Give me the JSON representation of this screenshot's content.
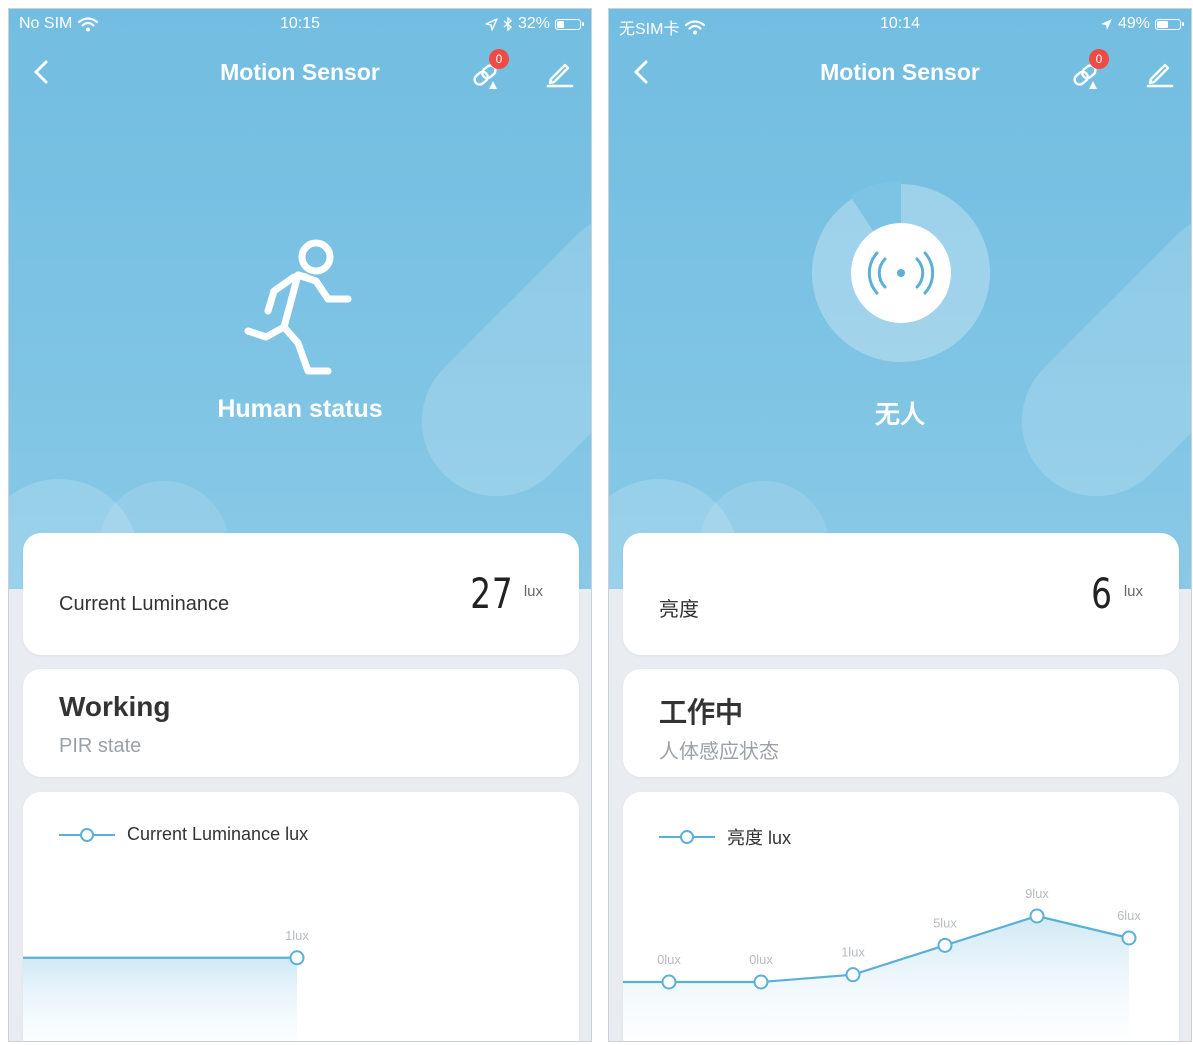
{
  "colors": {
    "hero": "#7dc3e4",
    "accent_line": "#5bb0d8",
    "badge": "#f04a45",
    "card": "#ffffff"
  },
  "left": {
    "status": {
      "carrier": "No SIM",
      "time": "10:15",
      "battery": "32%",
      "battery_level": 0.32,
      "icons": [
        "wifi-icon",
        "location-arrow-icon",
        "bluetooth-icon",
        "battery-icon"
      ]
    },
    "nav": {
      "title": "Motion Sensor",
      "badge": "0"
    },
    "hero_icon": "running-person-icon",
    "state_label": "Human status",
    "luminance": {
      "label": "Current Luminance",
      "value": "27",
      "unit": "lux"
    },
    "pir": {
      "title": "Working",
      "subtitle": "PIR state"
    },
    "chart": {
      "legend": "Current Luminance lux"
    }
  },
  "right": {
    "status": {
      "carrier": "无SIM卡",
      "time": "10:14",
      "battery": "49%",
      "battery_level": 0.49,
      "icons": [
        "wifi-icon",
        "location-arrow-icon",
        "battery-icon"
      ]
    },
    "nav": {
      "title": "Motion Sensor",
      "badge": "0"
    },
    "hero_icon": "radar-signal-icon",
    "state_label": "无人",
    "luminance": {
      "label": "亮度",
      "value": "6",
      "unit": "lux"
    },
    "pir": {
      "title": "工作中",
      "subtitle": "人体感应状态"
    },
    "chart": {
      "legend": "亮度 lux"
    }
  },
  "chart_data": [
    {
      "type": "line",
      "series": [
        {
          "name": "Current Luminance lux",
          "values": [
            1
          ],
          "labels": [
            "1lux"
          ]
        }
      ]
    },
    {
      "type": "line",
      "series": [
        {
          "name": "亮度 lux",
          "values": [
            0,
            0,
            1,
            5,
            9,
            6
          ],
          "labels": [
            "0lux",
            "0lux",
            "1lux",
            "5lux",
            "9lux",
            "6lux"
          ]
        }
      ]
    }
  ]
}
